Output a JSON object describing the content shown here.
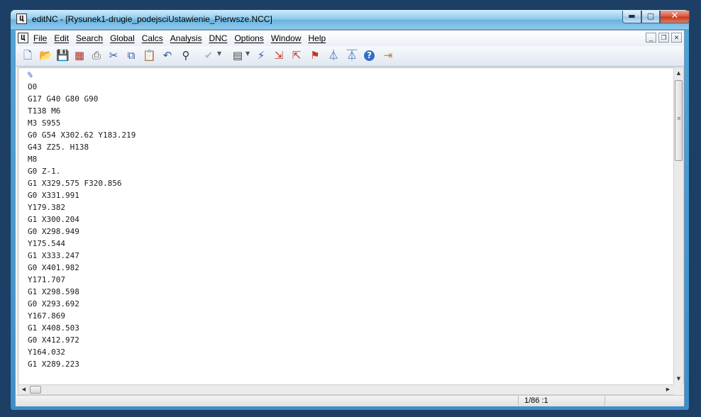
{
  "window": {
    "app_icon_glyph": "Ц",
    "title": "editNC - [Rysunek1-drugie_podejsciUstawienie_Pierwsze.NCC]",
    "controls": {
      "minimize": "▬",
      "maximize": "▢",
      "close": "✕"
    }
  },
  "menubar": {
    "doc_icon_glyph": "Ц",
    "items": [
      "File",
      "Edit",
      "Search",
      "Global",
      "Calcs",
      "Analysis",
      "DNC",
      "Options",
      "Window",
      "Help"
    ],
    "mdi": {
      "minimize": "_",
      "restore": "❐",
      "close": "✕"
    }
  },
  "toolbar": {
    "buttons": [
      {
        "name": "new-file-icon",
        "glyph": "🗋",
        "color": "#2e5aa8"
      },
      {
        "name": "open-folder-icon",
        "glyph": "📂",
        "color": "#d9a21b"
      },
      {
        "name": "save-icon",
        "glyph": "💾",
        "color": "#c0392b"
      },
      {
        "name": "save-all-icon",
        "glyph": "▦",
        "color": "#b03025"
      },
      {
        "name": "print-icon",
        "glyph": "⎙",
        "color": "#555555"
      },
      {
        "name": "cut-icon",
        "glyph": "✂",
        "color": "#2e5aa8"
      },
      {
        "name": "copy-icon",
        "glyph": "⧉",
        "color": "#2e5aa8"
      },
      {
        "name": "paste-icon",
        "glyph": "📋",
        "color": "#b8860b"
      },
      {
        "name": "undo-icon",
        "glyph": "↶",
        "color": "#2e5aa8"
      },
      {
        "name": "find-icon",
        "glyph": "⚲",
        "color": "#333333"
      },
      {
        "name": "check-icon",
        "glyph": "✔",
        "color": "#b8b8b8"
      },
      {
        "name": "macro-icon",
        "glyph": "▤",
        "color": "#444444"
      },
      {
        "name": "transmit-icon",
        "glyph": "⚡",
        "color": "#2e5aa8"
      },
      {
        "name": "send-icon",
        "glyph": "⇲",
        "color": "#c0392b"
      },
      {
        "name": "receive-icon",
        "glyph": "⇱",
        "color": "#c0392b"
      },
      {
        "name": "file-info-icon",
        "glyph": "⚑",
        "color": "#c0392b"
      },
      {
        "name": "sort-ascending-icon",
        "glyph": "⏃",
        "color": "#1f5ba8"
      },
      {
        "name": "sort-descending-icon",
        "glyph": "⏄",
        "color": "#1f5ba8"
      },
      {
        "name": "help-icon",
        "glyph": "?",
        "color": "#ffffff"
      },
      {
        "name": "exit-icon",
        "glyph": "⇥",
        "color": "#d9772b"
      }
    ]
  },
  "editor": {
    "lines": [
      "%",
      "O0",
      "G17 G40 G80 G90",
      "T138 M6",
      "M3 S955",
      "G0 G54 X302.62 Y183.219",
      "G43 Z25. H138",
      "M8",
      "G0 Z-1.",
      "G1 X329.575 F320.856",
      "G0 X331.991",
      "Y179.382",
      "G1 X300.204",
      "G0 X298.949",
      "Y175.544",
      "G1 X333.247",
      "G0 X401.982",
      "Y171.707",
      "G1 X298.598",
      "G0 X293.692",
      "Y167.869",
      "G1 X408.503",
      "G0 X412.972",
      "Y164.032",
      "G1 X289.223"
    ]
  },
  "scrollbars": {
    "up": "▲",
    "down": "▼",
    "left": "◀",
    "right": "▶",
    "grip": "≡"
  },
  "status": {
    "position": "1/86 :1"
  }
}
